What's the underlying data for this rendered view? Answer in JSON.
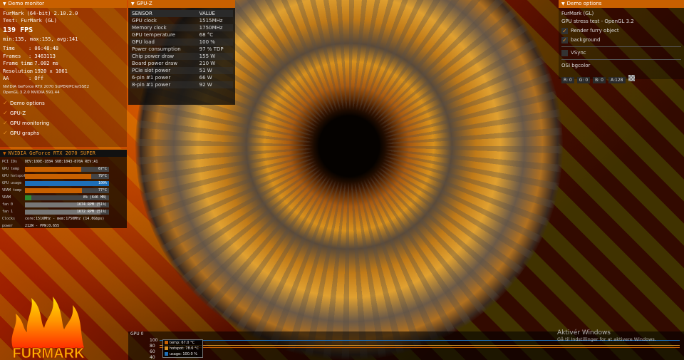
{
  "demo_monitor": {
    "header": "Demo monitor",
    "app_title": "FurMark (64-bit) 2.10.2.0",
    "test": "Test: FurMark (GL)",
    "fps": "139 FPS",
    "fps_stats": "min:135, max:155, avg:141",
    "stats": [
      {
        "k": "Time",
        "v": ": 06:48:48"
      },
      {
        "k": "Frames",
        "v": ": 3463113"
      },
      {
        "k": "Frame time",
        "v": ": 7.002 ms"
      },
      {
        "k": "Resolution",
        "v": ": 1920 x 1061"
      },
      {
        "k": "AA",
        "v": ": Off"
      }
    ],
    "gpu_line1": "NVIDIA GeForce RTX 2070 SUPER/PCIe/SSE2",
    "gpu_line2": "OpenGL 3.2.0 NVIDIA 591.44",
    "options": [
      "Demo options",
      "GPU-Z",
      "GPU monitoring",
      "GPU graphs"
    ]
  },
  "gpu_info": {
    "header": "NVIDIA GeForce RTX 2070 SUPER",
    "pci_label": "PCI IDs",
    "pci_value": "DEV:10DE-1E84 SUB:1043-870A REV:A1",
    "bars": [
      {
        "label": "GPU temp",
        "text": "67°C",
        "pct": 67,
        "color": "#c86000"
      },
      {
        "label": "GPU hotspot",
        "text": "79°C",
        "pct": 79,
        "color": "#c86000"
      },
      {
        "label": "GPU usage",
        "text": "100%",
        "pct": 100,
        "color": "#1e6fb8"
      },
      {
        "label": "VRAM temp",
        "text": "77°C",
        "pct": 68,
        "color": "#c86000"
      },
      {
        "label": "VRAM",
        "text": "8% (646 MB)",
        "pct": 8,
        "color": "#2e8b2e"
      },
      {
        "label": "fan 0",
        "text": "1674 RPM (51%)",
        "pct": 90,
        "color": "#777"
      },
      {
        "label": "fan 1",
        "text": "1672 RPM (51%)",
        "pct": 90,
        "color": "#777"
      }
    ],
    "clocks_label": "Clocks",
    "clocks_value": "core:1516MHz - mem:1750MHz (14.0Gbps)",
    "power_label": "power",
    "power_value": "212W - PPW:0.655"
  },
  "gpuz": {
    "header": "GPU-Z",
    "col_sensor": "SENSOR",
    "col_value": "VALUE",
    "rows": [
      {
        "k": "GPU clock",
        "v": "1515MHz"
      },
      {
        "k": "Memory clock",
        "v": "1750MHz"
      },
      {
        "k": "GPU temperature",
        "v": "68 °C"
      },
      {
        "k": "GPU load",
        "v": "100 %"
      },
      {
        "k": "Power consumption",
        "v": "97 % TDP"
      },
      {
        "k": "Chip power draw",
        "v": "155 W"
      },
      {
        "k": "Board power draw",
        "v": "210 W"
      },
      {
        "k": "PCIe slot power",
        "v": "51 W"
      },
      {
        "k": "6-pin #1 power",
        "v": "66 W"
      },
      {
        "k": "8-pin #1 power",
        "v": "92 W"
      }
    ]
  },
  "demo_options": {
    "header": "Demo options",
    "title": "FurMark (GL)",
    "subtitle": "GPU stress test - OpenGL 3.2",
    "render_furry": "Render furry object",
    "background": "background",
    "vsync": "VSync",
    "osi_label": "OSI bgcolor",
    "r": "R: 0",
    "g": "G: 0",
    "b": "B: 0",
    "a": "A:128"
  },
  "graph": {
    "title": "GPU 0",
    "ticks": [
      "100",
      "80",
      "60",
      "40"
    ],
    "legend": [
      {
        "text": "temp: 67.0 °C",
        "color": "#c86000"
      },
      {
        "text": "hotspot: 78.6 °C",
        "color": "#d89020"
      },
      {
        "text": "usage: 100.0 %",
        "color": "#1e6fb8"
      }
    ]
  },
  "windows": {
    "activate": "Aktivér Windows",
    "hint": "Gå til Indstillinger for at aktivere Windows."
  },
  "logo_text": "FURMARK"
}
